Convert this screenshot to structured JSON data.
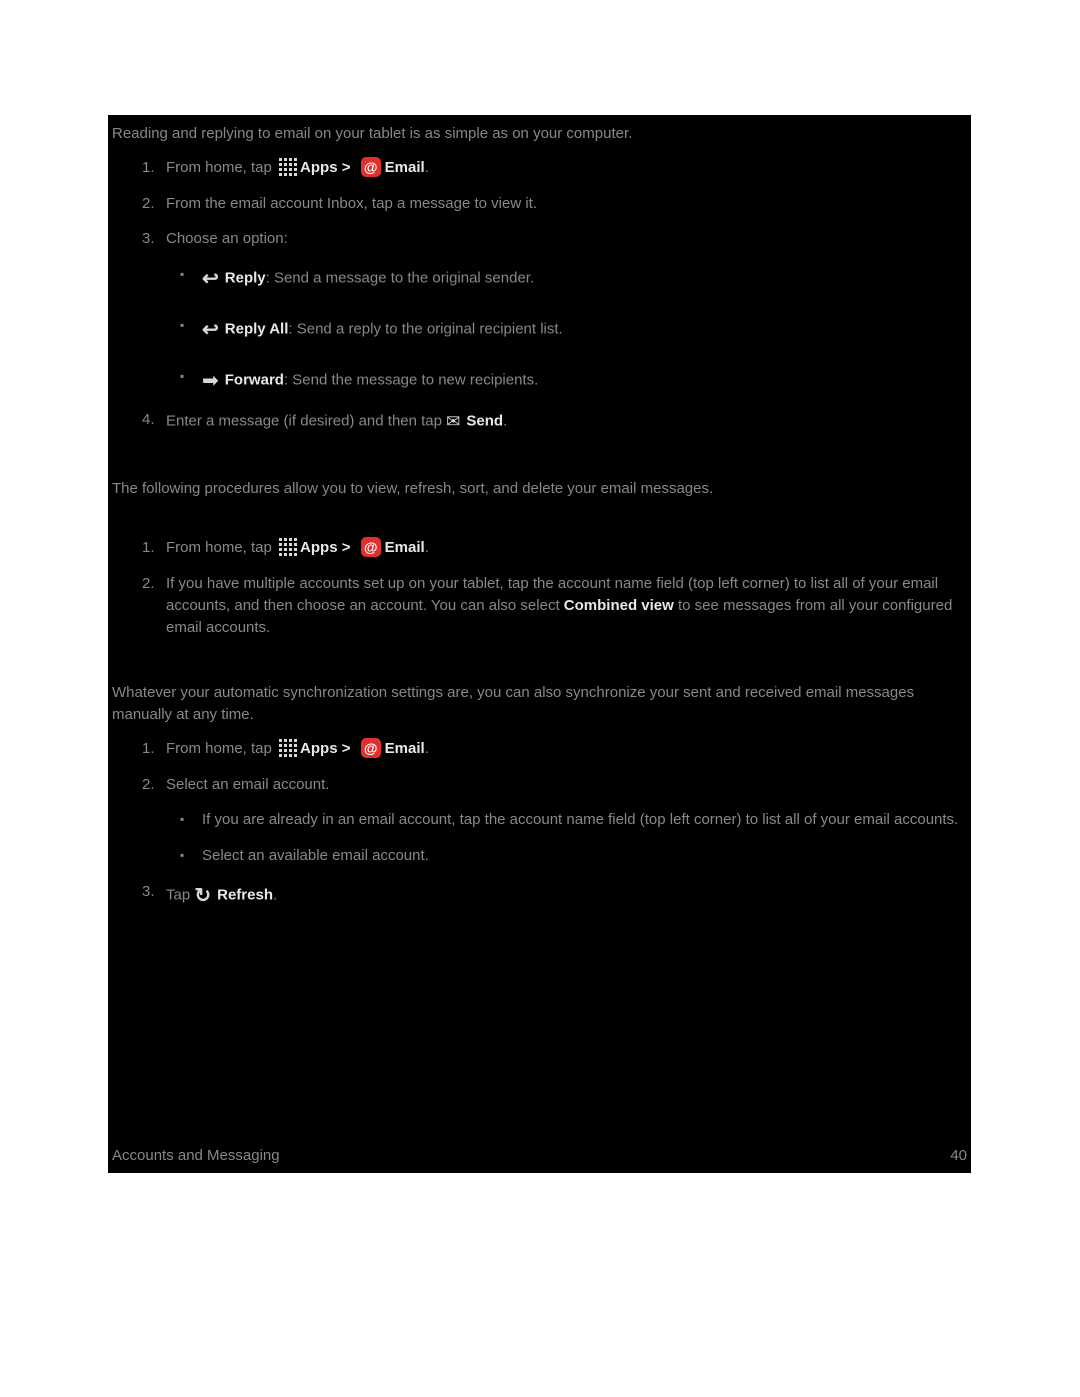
{
  "intro1": "Reading and replying to email on your tablet is as simple as on your computer.",
  "from_home_a": "From home, tap ",
  "apps_lbl": "Apps",
  "gt": " > ",
  "email_lbl": "Email",
  "period": ".",
  "s1_li2": "From the email account Inbox, tap a message to view it.",
  "s1_li3": "Choose an option:",
  "reply_b": "Reply",
  "reply_t": ": Send a message to the original sender.",
  "replyall_b": "Reply All",
  "replyall_t": ": Send a reply to the original recipient list.",
  "forward_b": "Forward",
  "forward_t": ": Send the message to new recipients.",
  "s1_li4a": "Enter a message (if desired) and then tap ",
  "send_b": "Send",
  "intro2": "The following procedures allow you to view, refresh, sort, and delete your email messages.",
  "s2_li2a": "If you have multiple accounts set up on your tablet, tap the account name field (top left corner) to list all of your email accounts, and then choose an account. You can also select ",
  "combined_b": "Combined view",
  "s2_li2b": " to see messages from all your configured email accounts.",
  "intro3": "Whatever your automatic synchronization settings are, you can also synchronize your sent and received email messages manually at any time.",
  "s3_li2": "Select an email account.",
  "s3_sub1": "If you are already in an email account, tap the account name field (top left corner) to list all of your email accounts.",
  "s3_sub2": "Select an available email account.",
  "s3_li3a": "Tap ",
  "refresh_b": "Refresh",
  "footer_left": "Accounts and Messaging",
  "footer_right": "40"
}
